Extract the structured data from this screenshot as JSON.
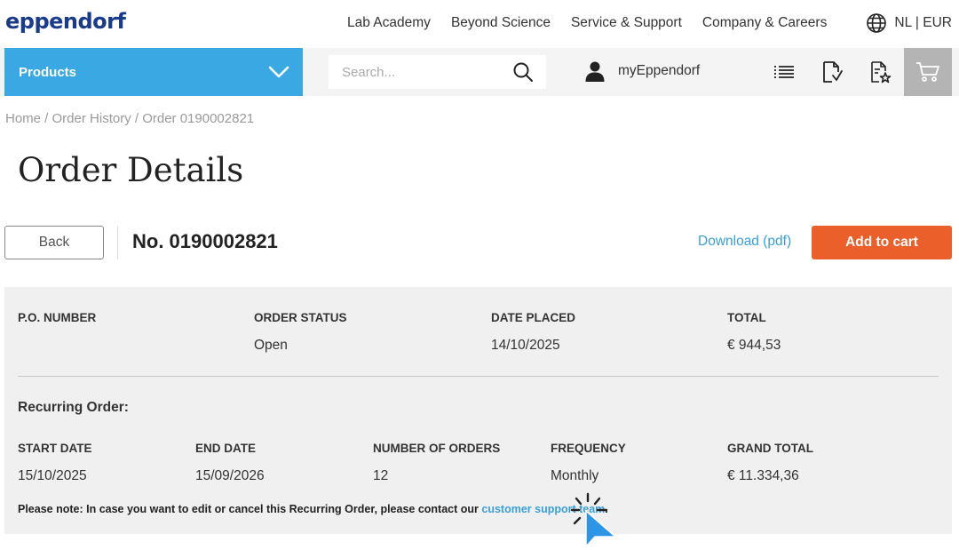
{
  "header": {
    "logo": "eppendorf",
    "nav": [
      "Lab Academy",
      "Beyond Science",
      "Service & Support",
      "Company & Careers"
    ],
    "locale": "NL | EUR"
  },
  "navbar": {
    "products_label": "Products",
    "search_placeholder": "Search...",
    "account_label": "myEppendorf"
  },
  "breadcrumb": "Home / Order History / Order 0190002821",
  "page_title": "Order Details",
  "actions": {
    "back_label": "Back",
    "order_number": "No. 0190002821",
    "download_label": "Download (pdf)",
    "add_to_cart_label": "Add to cart"
  },
  "summary": {
    "po_label": "P.O. NUMBER",
    "status_label": "ORDER STATUS",
    "status_value": "Open",
    "date_label": "DATE PLACED",
    "date_value": "14/10/2025",
    "total_label": "TOTAL",
    "total_value": "€ 944,53"
  },
  "recurring": {
    "title": "Recurring Order:",
    "start_label": "START DATE",
    "start_value": "15/10/2025",
    "end_label": "END DATE",
    "end_value": "15/09/2026",
    "count_label": "NUMBER OF ORDERS",
    "count_value": "12",
    "freq_label": "FREQUENCY",
    "freq_value": "Monthly",
    "grand_label": "GRAND TOTAL",
    "grand_value": "€ 11.334,36",
    "note_text": "Please note: In case you want to edit or cancel this Recurring Order, please contact our ",
    "note_link": "customer support team",
    "note_end": "."
  },
  "colors": {
    "brand_blue": "#1a3a8c",
    "products_blue": "#39a8e3",
    "link_blue": "#3a9fd8",
    "cta_orange": "#ea5f2a",
    "panel_gray": "#f0f0f0"
  },
  "icons": [
    "globe-icon",
    "chevron-down-icon",
    "search-icon",
    "user-icon",
    "list-icon",
    "document-download-icon",
    "document-star-icon",
    "cart-icon",
    "cursor-icon"
  ]
}
